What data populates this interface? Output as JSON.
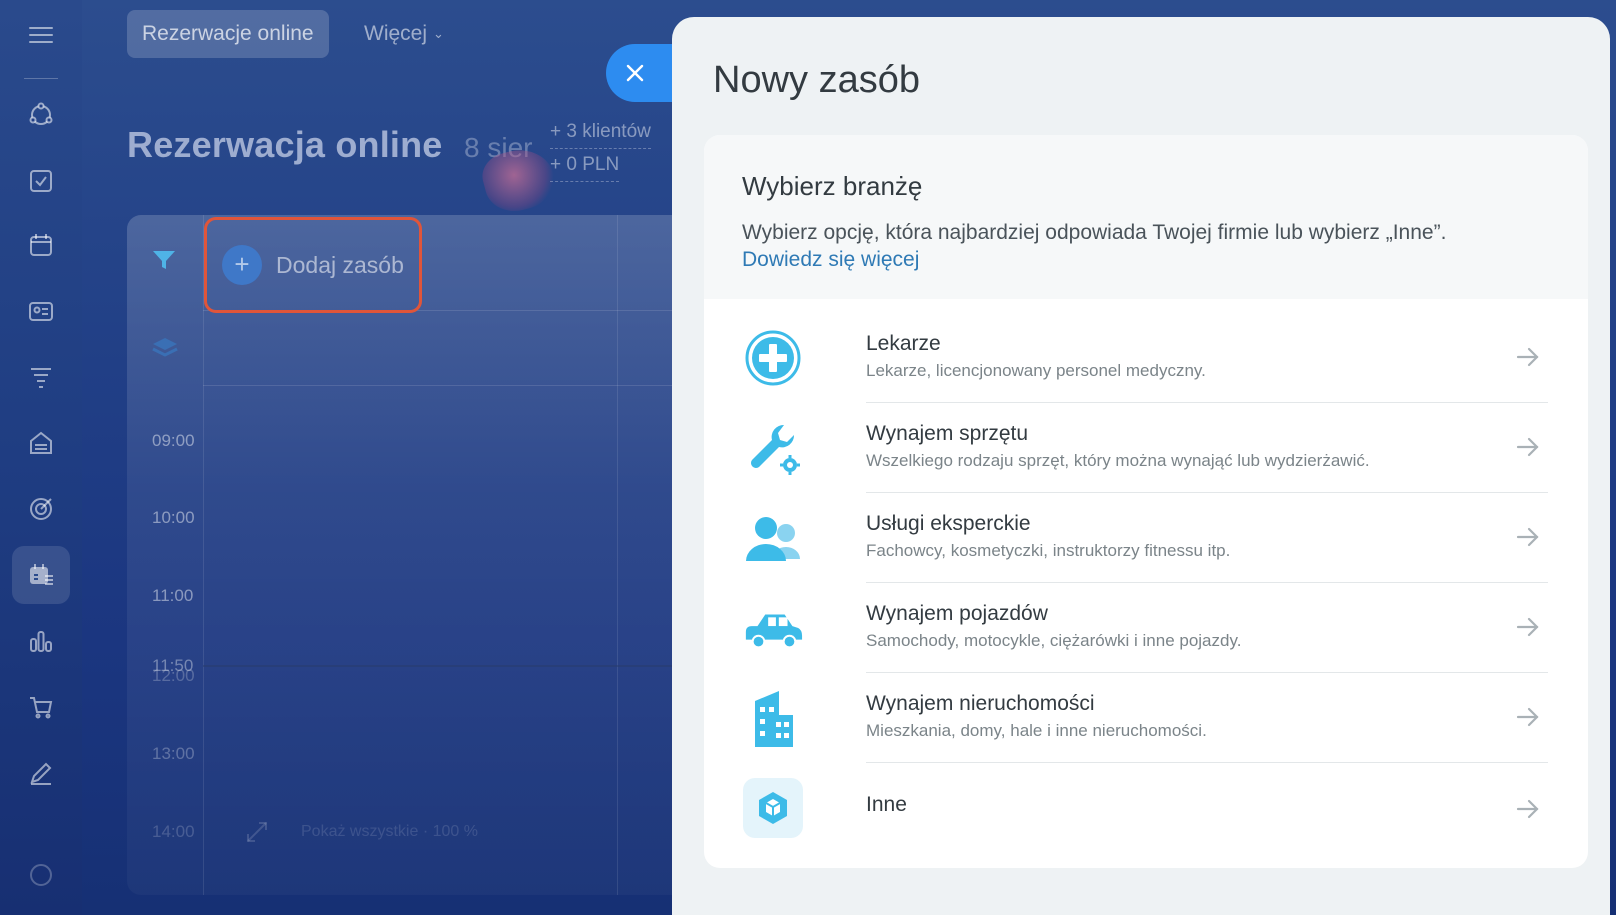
{
  "topbar": {
    "active_tab": "Rezerwacje online",
    "more": "Więcej"
  },
  "page": {
    "title": "Rezerwacja online",
    "date": "8 sier",
    "stats": [
      "+ 3 klientów",
      "+ 0 PLN"
    ]
  },
  "calendar": {
    "add_resource": "Dodaj zasób",
    "times": [
      "09:00",
      "10:00",
      "11:00",
      "11:50",
      "12:00",
      "13:00",
      "14:00"
    ],
    "footer": "Pokaż wszystkie · 100 %"
  },
  "sidebar_icons": [
    "menu-icon",
    "crm-icon",
    "tasks-icon",
    "calendar-icon",
    "contacts-icon",
    "filter-funnel-icon",
    "store-icon",
    "target-icon",
    "booking-icon",
    "analytics-icon",
    "cart-icon",
    "edit-icon",
    "help-icon"
  ],
  "slider": {
    "title": "Nowy zasób",
    "card_title": "Wybierz branżę",
    "card_desc": "Wybierz opcję, która najbardziej odpowiada Twojej firmie lub wybierz „Inne”.",
    "learn_more": "Dowiedz się więcej",
    "options": [
      {
        "title": "Lekarze",
        "desc": "Lekarze, licencjonowany personel medyczny.",
        "icon": "medical-cross-icon"
      },
      {
        "title": "Wynajem sprzętu",
        "desc": "Wszelkiego rodzaju sprzęt, który można wynająć lub wydzierżawić.",
        "icon": "wrench-gear-icon"
      },
      {
        "title": "Usługi eksperckie",
        "desc": "Fachowcy, kosmetyczki, instruktorzy fitnessu itp.",
        "icon": "people-icon"
      },
      {
        "title": "Wynajem pojazdów",
        "desc": "Samochody, motocykle, ciężarówki i inne pojazdy.",
        "icon": "car-icon"
      },
      {
        "title": "Wynajem nieruchomości",
        "desc": "Mieszkania, domy, hale i inne nieruchomości.",
        "icon": "building-icon"
      },
      {
        "title": "Inne",
        "desc": "",
        "icon": "cube-icon"
      }
    ]
  },
  "colors": {
    "accent": "#2d8cf0",
    "icon_blue": "#3dbbe8",
    "highlight": "#e0553a"
  }
}
